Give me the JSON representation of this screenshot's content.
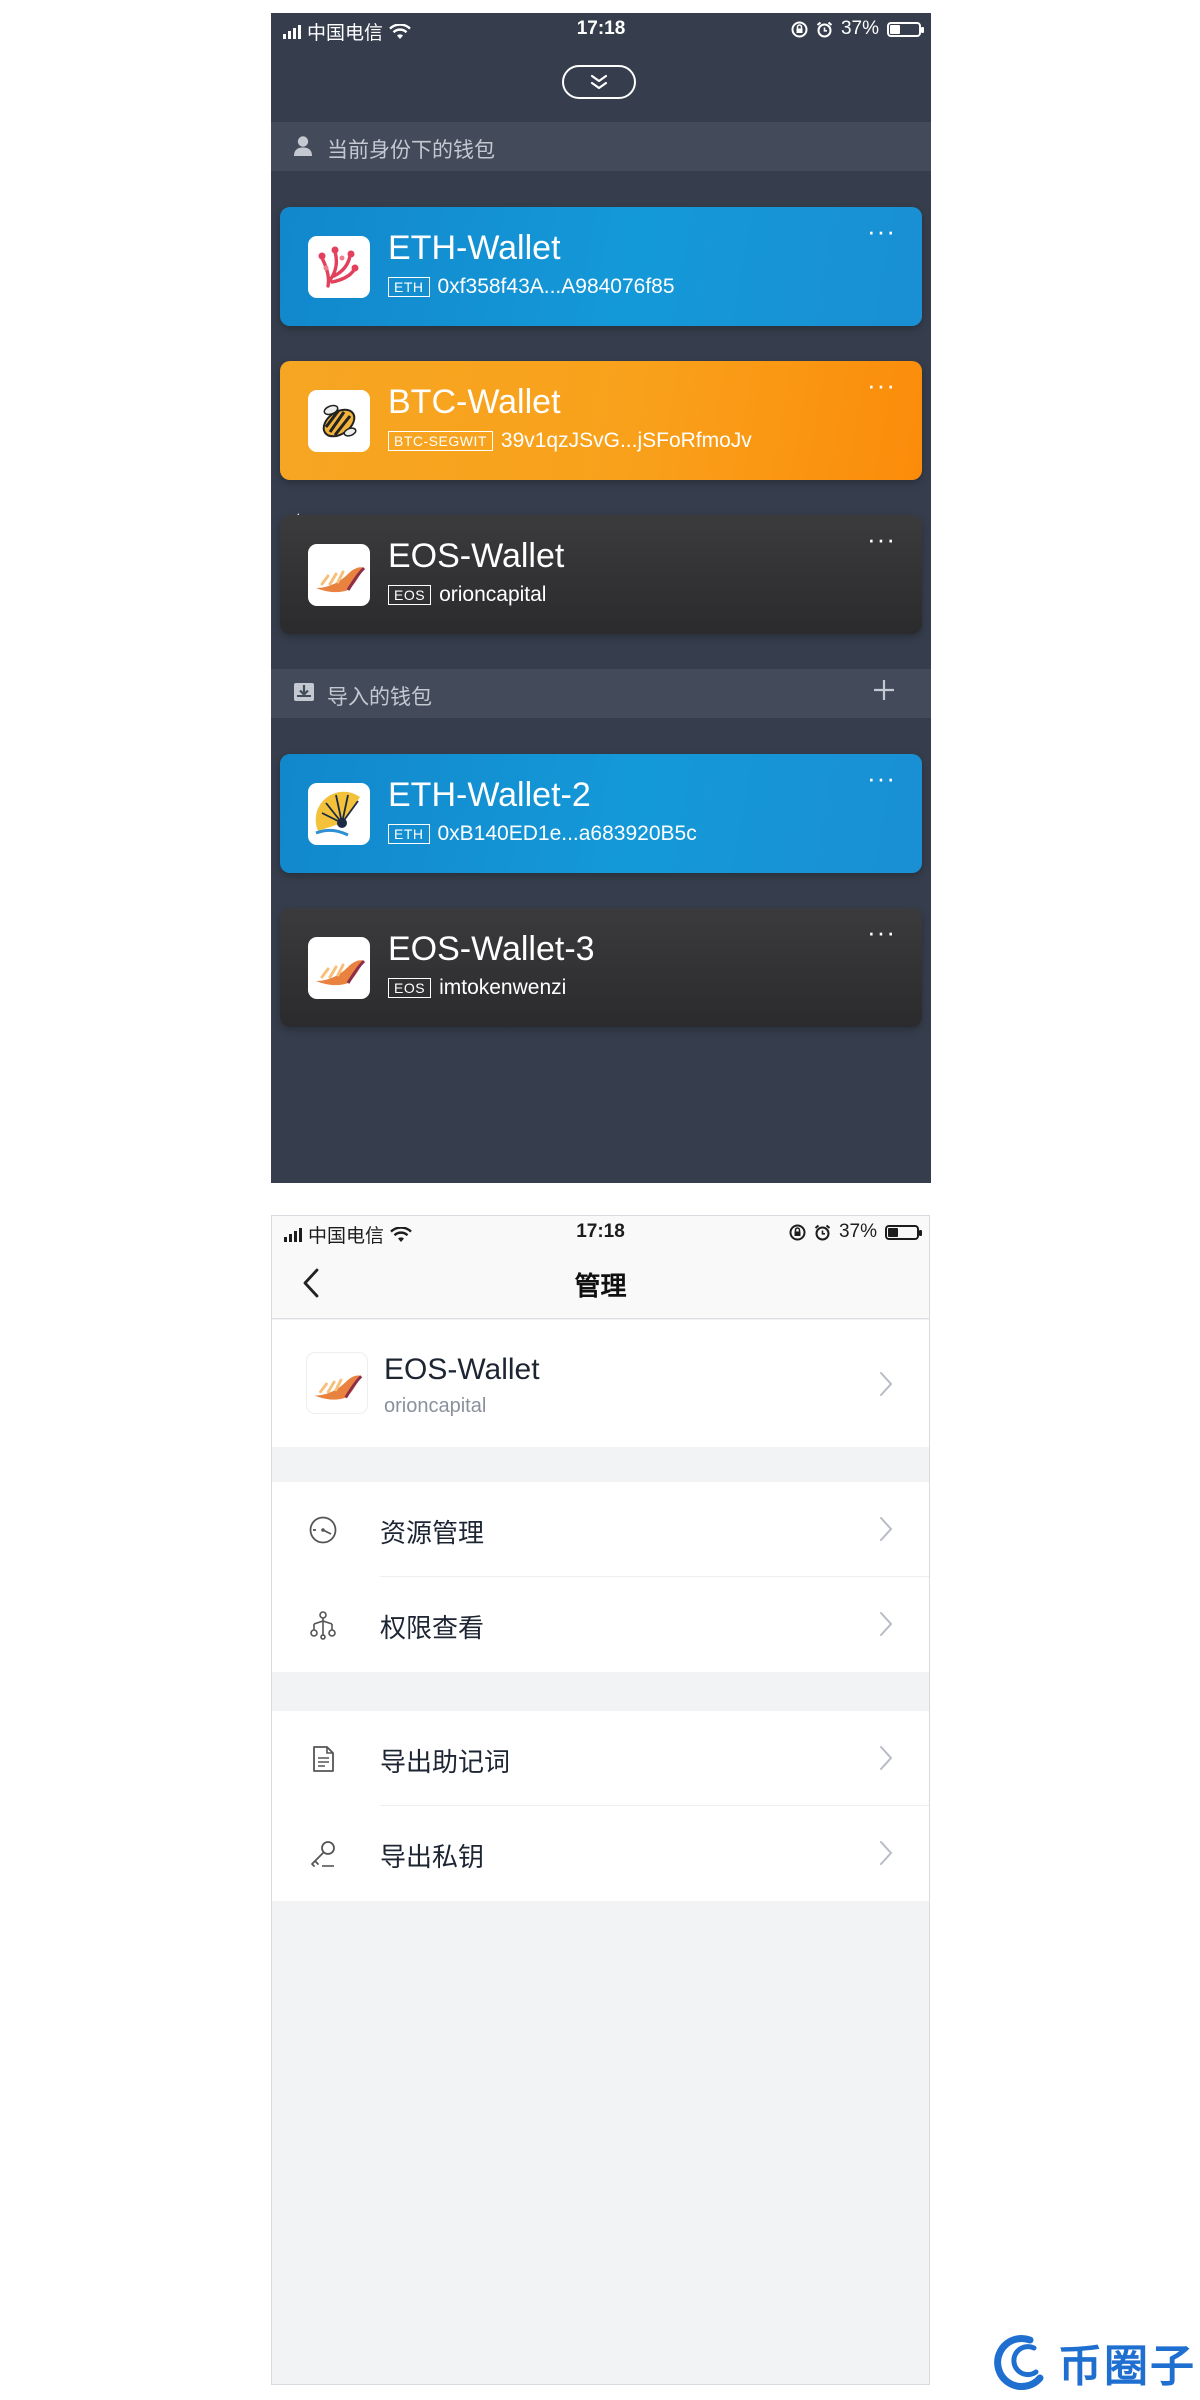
{
  "status_bar": {
    "carrier": "中国电信",
    "time": "17:18",
    "battery": "37%",
    "battery_level": 0.37
  },
  "wallet_list": {
    "identity_section": "当前身份下的钱包",
    "imported_section": "导入的钱包",
    "identity_wallets": [
      {
        "name": "ETH-Wallet",
        "chain": "ETH",
        "address": "0xf358f43A...A984076f85",
        "more": "···"
      },
      {
        "name": "BTC-Wallet",
        "chain": "BTC-SEGWIT",
        "address": "39v1qzJSvG...jSFoRfmoJv",
        "more": "···"
      },
      {
        "name": "EOS-Wallet",
        "chain": "EOS",
        "address": "orioncapital",
        "more": "···"
      }
    ],
    "imported_wallets": [
      {
        "name": "ETH-Wallet-2",
        "chain": "ETH",
        "address": "0xB140ED1e...a683920B5c",
        "more": "···"
      },
      {
        "name": "EOS-Wallet-3",
        "chain": "EOS",
        "address": "imtokenwenzi",
        "more": "···"
      }
    ]
  },
  "manage": {
    "title": "管理",
    "wallet": {
      "name": "EOS-Wallet",
      "account": "orioncapital"
    },
    "group1": [
      {
        "label": "资源管理",
        "icon": "gauge-icon"
      },
      {
        "label": "权限查看",
        "icon": "permission-tree-icon"
      }
    ],
    "group2": [
      {
        "label": "导出助记词",
        "icon": "document-icon"
      },
      {
        "label": "导出私钥",
        "icon": "key-icon"
      }
    ]
  },
  "watermark": {
    "text": "币圈子"
  },
  "colors": {
    "dark_bg": "#363e4d",
    "section_bg": "#434b5a",
    "eth_card": "#1499d8",
    "btc_card": "#f9a11b",
    "eos_card": "#2f2f31",
    "watermark": "#1f6fd1"
  }
}
